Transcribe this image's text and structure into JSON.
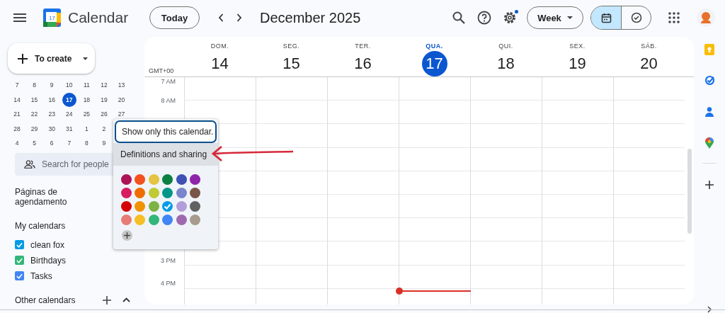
{
  "app": {
    "title": "Calendar",
    "logo_day": "17"
  },
  "topbar": {
    "today": "Today",
    "period": "December 2025",
    "view": "Week",
    "settings_badge": true,
    "modes": [
      {
        "kind": "calendar",
        "selected": true
      },
      {
        "kind": "tasks",
        "selected": false
      }
    ]
  },
  "sidebar": {
    "create": "To create",
    "mini_calendar": [
      [
        {
          "d": "7",
          "selected": false
        },
        {
          "d": "8",
          "selected": false
        },
        {
          "d": "9",
          "selected": false
        },
        {
          "d": "10",
          "selected": false
        },
        {
          "d": "11",
          "selected": false
        },
        {
          "d": "12",
          "selected": false
        },
        {
          "d": "13",
          "selected": false
        }
      ],
      [
        {
          "d": "14",
          "selected": false
        },
        {
          "d": "15",
          "selected": false
        },
        {
          "d": "16",
          "selected": false
        },
        {
          "d": "17",
          "selected": true
        },
        {
          "d": "18",
          "selected": false
        },
        {
          "d": "19",
          "selected": false
        },
        {
          "d": "20",
          "selected": false
        }
      ],
      [
        {
          "d": "21",
          "selected": false
        },
        {
          "d": "22",
          "selected": false
        },
        {
          "d": "23",
          "selected": false
        },
        {
          "d": "24",
          "selected": false
        },
        {
          "d": "25",
          "selected": false
        },
        {
          "d": "26",
          "selected": false
        },
        {
          "d": "27",
          "selected": false
        }
      ],
      [
        {
          "d": "28",
          "selected": false
        },
        {
          "d": "29",
          "selected": false
        },
        {
          "d": "30",
          "selected": false
        },
        {
          "d": "31",
          "selected": false
        },
        {
          "d": "1",
          "selected": false
        },
        {
          "d": "2",
          "selected": false
        }
      ],
      [
        {
          "d": "4",
          "selected": false
        },
        {
          "d": "5",
          "selected": false
        },
        {
          "d": "6",
          "selected": false
        },
        {
          "d": "7",
          "selected": false
        },
        {
          "d": "8",
          "selected": false
        },
        {
          "d": "9",
          "selected": false
        }
      ]
    ],
    "search_placeholder": "Search for people",
    "scheduling": "Páginas de agendamento",
    "my_calendars": {
      "title": "My calendars",
      "items": [
        {
          "name": "clean fox",
          "checked": true,
          "color": "#039be5"
        },
        {
          "name": "Birthdays",
          "checked": true,
          "color": "#33b679"
        },
        {
          "name": "Tasks",
          "checked": true,
          "color": "#4285f4"
        }
      ]
    },
    "other_calendars": "Other calendars"
  },
  "week": {
    "timezone": "GMT+00",
    "days": [
      {
        "name": "DOM.",
        "date": "14",
        "today": false
      },
      {
        "name": "SEG.",
        "date": "15",
        "today": false
      },
      {
        "name": "TER.",
        "date": "16",
        "today": false
      },
      {
        "name": "QUA.",
        "date": "17",
        "today": true
      },
      {
        "name": "QUI.",
        "date": "18",
        "today": false
      },
      {
        "name": "SEX.",
        "date": "19",
        "today": false
      },
      {
        "name": "SÁB.",
        "date": "20",
        "today": false
      }
    ],
    "time_labels_top": [
      "7 AM",
      "8 AM"
    ],
    "time_labels_bottom": [
      "3 PM",
      "4 PM"
    ]
  },
  "popup": {
    "items": [
      {
        "label": "Show only this calendar.",
        "focused": true,
        "highlighted": false
      },
      {
        "label": "Definitions and sharing",
        "focused": false,
        "highlighted": true
      }
    ],
    "colors": [
      {
        "color": "#ad1457",
        "selected": false
      },
      {
        "color": "#f4511e",
        "selected": false
      },
      {
        "color": "#e4c441",
        "selected": false
      },
      {
        "color": "#0b8043",
        "selected": false
      },
      {
        "color": "#3f51b5",
        "selected": false
      },
      {
        "color": "#8e24aa",
        "selected": false
      },
      {
        "color": "#d81b60",
        "selected": false
      },
      {
        "color": "#ef6c00",
        "selected": false
      },
      {
        "color": "#c0ca33",
        "selected": false
      },
      {
        "color": "#009688",
        "selected": false
      },
      {
        "color": "#7986cb",
        "selected": false
      },
      {
        "color": "#795548",
        "selected": false
      },
      {
        "color": "#d50000",
        "selected": false
      },
      {
        "color": "#f09300",
        "selected": false
      },
      {
        "color": "#7cb342",
        "selected": false
      },
      {
        "color": "#039be5",
        "selected": true
      },
      {
        "color": "#b39ddb",
        "selected": false
      },
      {
        "color": "#616161",
        "selected": false
      },
      {
        "color": "#e67c73",
        "selected": false
      },
      {
        "color": "#f6bf26",
        "selected": false
      },
      {
        "color": "#33b679",
        "selected": false
      },
      {
        "color": "#4285f4",
        "selected": false
      },
      {
        "color": "#9e69af",
        "selected": false
      },
      {
        "color": "#a79b8e",
        "selected": false
      }
    ]
  }
}
